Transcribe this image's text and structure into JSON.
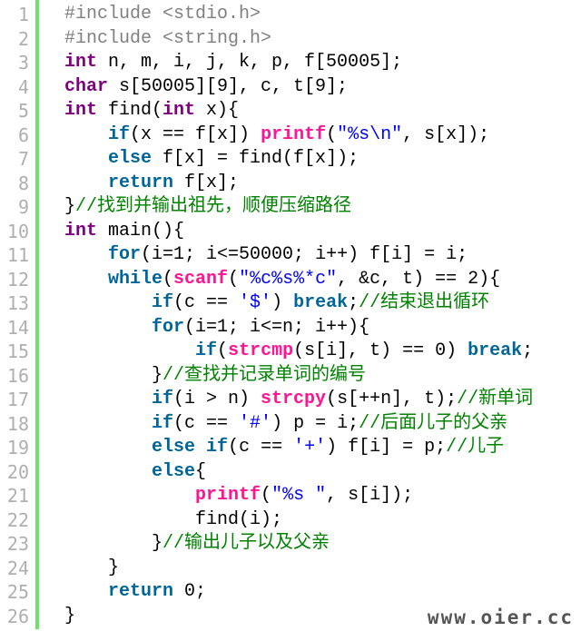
{
  "colors": {
    "gutter_rule": "#6ce26c",
    "line_number": "#afafaf",
    "keyword": "#006699",
    "type_keyword": "#7f007f",
    "function": "#ff1493",
    "preprocessor": "#808080",
    "string": "#0000ff",
    "comment": "#008200",
    "plain": "#000000"
  },
  "watermark": "www.oier.cc",
  "lines": [
    {
      "number": "1",
      "tokens": [
        {
          "t": "p",
          "v": "#include <stdio.h>"
        }
      ]
    },
    {
      "number": "2",
      "tokens": [
        {
          "t": "p",
          "v": "#include <string.h>"
        }
      ]
    },
    {
      "number": "3",
      "tokens": [
        {
          "t": "t",
          "v": "int"
        },
        {
          "t": "x",
          "v": " n, m, i, j, k, p, f[50005];"
        }
      ]
    },
    {
      "number": "4",
      "tokens": [
        {
          "t": "t",
          "v": "char"
        },
        {
          "t": "x",
          "v": " s[50005][9], c, t[9];"
        }
      ]
    },
    {
      "number": "5",
      "tokens": [
        {
          "t": "t",
          "v": "int"
        },
        {
          "t": "x",
          "v": " find("
        },
        {
          "t": "t",
          "v": "int"
        },
        {
          "t": "x",
          "v": " x){"
        }
      ]
    },
    {
      "number": "6",
      "tokens": [
        {
          "t": "x",
          "v": "    "
        },
        {
          "t": "k",
          "v": "if"
        },
        {
          "t": "x",
          "v": "(x == f[x]) "
        },
        {
          "t": "f",
          "v": "printf"
        },
        {
          "t": "x",
          "v": "("
        },
        {
          "t": "s",
          "v": "\"%s\\n\""
        },
        {
          "t": "x",
          "v": ", s[x]);"
        }
      ]
    },
    {
      "number": "7",
      "tokens": [
        {
          "t": "x",
          "v": "    "
        },
        {
          "t": "k",
          "v": "else"
        },
        {
          "t": "x",
          "v": " f[x] = find(f[x]);"
        }
      ]
    },
    {
      "number": "8",
      "tokens": [
        {
          "t": "x",
          "v": "    "
        },
        {
          "t": "k",
          "v": "return"
        },
        {
          "t": "x",
          "v": " f[x];"
        }
      ]
    },
    {
      "number": "9",
      "tokens": [
        {
          "t": "x",
          "v": "}"
        },
        {
          "t": "c",
          "v": "//找到并输出祖先，顺便压缩路径"
        }
      ]
    },
    {
      "number": "10",
      "tokens": [
        {
          "t": "t",
          "v": "int"
        },
        {
          "t": "x",
          "v": " main(){"
        }
      ]
    },
    {
      "number": "11",
      "tokens": [
        {
          "t": "x",
          "v": "    "
        },
        {
          "t": "k",
          "v": "for"
        },
        {
          "t": "x",
          "v": "(i=1; i<=50000; i++) f[i] = i;"
        }
      ]
    },
    {
      "number": "12",
      "tokens": [
        {
          "t": "x",
          "v": "    "
        },
        {
          "t": "k",
          "v": "while"
        },
        {
          "t": "x",
          "v": "("
        },
        {
          "t": "f",
          "v": "scanf"
        },
        {
          "t": "x",
          "v": "("
        },
        {
          "t": "s",
          "v": "\"%c%s%*c\""
        },
        {
          "t": "x",
          "v": ", &c, t) == 2){"
        }
      ]
    },
    {
      "number": "13",
      "tokens": [
        {
          "t": "x",
          "v": "        "
        },
        {
          "t": "k",
          "v": "if"
        },
        {
          "t": "x",
          "v": "(c == "
        },
        {
          "t": "s",
          "v": "'$'"
        },
        {
          "t": "x",
          "v": ") "
        },
        {
          "t": "k",
          "v": "break"
        },
        {
          "t": "x",
          "v": ";"
        },
        {
          "t": "c",
          "v": "//结束退出循环"
        }
      ]
    },
    {
      "number": "14",
      "tokens": [
        {
          "t": "x",
          "v": "        "
        },
        {
          "t": "k",
          "v": "for"
        },
        {
          "t": "x",
          "v": "(i=1; i<=n; i++){"
        }
      ]
    },
    {
      "number": "15",
      "tokens": [
        {
          "t": "x",
          "v": "            "
        },
        {
          "t": "k",
          "v": "if"
        },
        {
          "t": "x",
          "v": "("
        },
        {
          "t": "f",
          "v": "strcmp"
        },
        {
          "t": "x",
          "v": "(s[i], t) == 0) "
        },
        {
          "t": "k",
          "v": "break"
        },
        {
          "t": "x",
          "v": ";"
        }
      ]
    },
    {
      "number": "16",
      "tokens": [
        {
          "t": "x",
          "v": "        }"
        },
        {
          "t": "c",
          "v": "//查找并记录单词的编号"
        }
      ]
    },
    {
      "number": "17",
      "tokens": [
        {
          "t": "x",
          "v": "        "
        },
        {
          "t": "k",
          "v": "if"
        },
        {
          "t": "x",
          "v": "(i > n) "
        },
        {
          "t": "f",
          "v": "strcpy"
        },
        {
          "t": "x",
          "v": "(s[++n], t);"
        },
        {
          "t": "c",
          "v": "//新单词"
        }
      ]
    },
    {
      "number": "18",
      "tokens": [
        {
          "t": "x",
          "v": "        "
        },
        {
          "t": "k",
          "v": "if"
        },
        {
          "t": "x",
          "v": "(c == "
        },
        {
          "t": "s",
          "v": "'#'"
        },
        {
          "t": "x",
          "v": ") p = i;"
        },
        {
          "t": "c",
          "v": "//后面儿子的父亲"
        }
      ]
    },
    {
      "number": "19",
      "tokens": [
        {
          "t": "x",
          "v": "        "
        },
        {
          "t": "k",
          "v": "else"
        },
        {
          "t": "x",
          "v": " "
        },
        {
          "t": "k",
          "v": "if"
        },
        {
          "t": "x",
          "v": "(c == "
        },
        {
          "t": "s",
          "v": "'+'"
        },
        {
          "t": "x",
          "v": ") f[i] = p;"
        },
        {
          "t": "c",
          "v": "//儿子"
        }
      ]
    },
    {
      "number": "20",
      "tokens": [
        {
          "t": "x",
          "v": "        "
        },
        {
          "t": "k",
          "v": "else"
        },
        {
          "t": "x",
          "v": "{"
        }
      ]
    },
    {
      "number": "21",
      "tokens": [
        {
          "t": "x",
          "v": "            "
        },
        {
          "t": "f",
          "v": "printf"
        },
        {
          "t": "x",
          "v": "("
        },
        {
          "t": "s",
          "v": "\"%s \""
        },
        {
          "t": "x",
          "v": ", s[i]);"
        }
      ]
    },
    {
      "number": "22",
      "tokens": [
        {
          "t": "x",
          "v": "            find(i);"
        }
      ]
    },
    {
      "number": "23",
      "tokens": [
        {
          "t": "x",
          "v": "        }"
        },
        {
          "t": "c",
          "v": "//输出儿子以及父亲"
        }
      ]
    },
    {
      "number": "24",
      "tokens": [
        {
          "t": "x",
          "v": "    }"
        }
      ]
    },
    {
      "number": "25",
      "tokens": [
        {
          "t": "x",
          "v": "    "
        },
        {
          "t": "k",
          "v": "return"
        },
        {
          "t": "x",
          "v": " 0;"
        }
      ]
    },
    {
      "number": "26",
      "tokens": [
        {
          "t": "x",
          "v": "}"
        }
      ]
    }
  ]
}
